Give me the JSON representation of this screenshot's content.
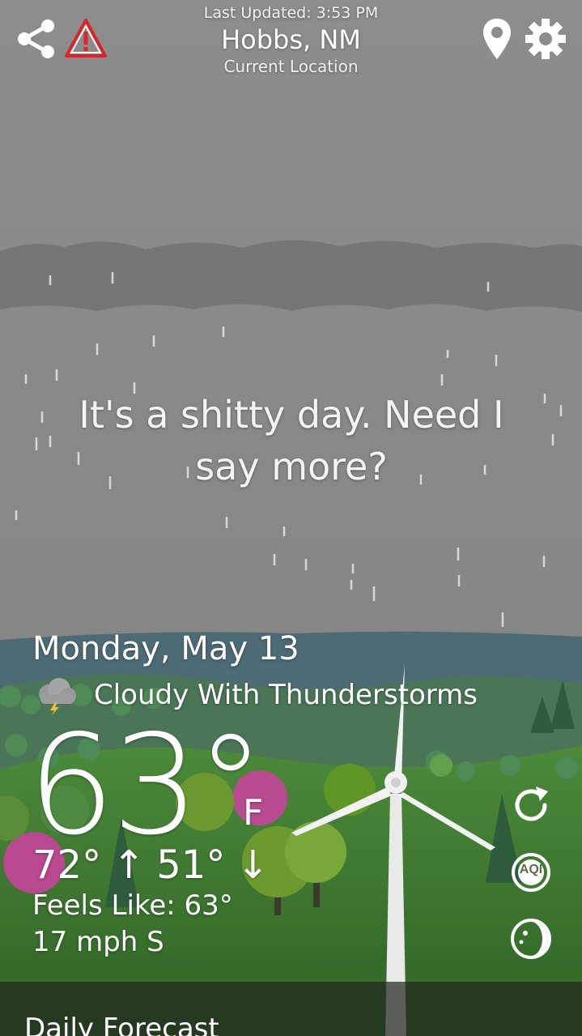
{
  "header": {
    "last_updated": "Last Updated: 3:53 PM",
    "city": "Hobbs, NM",
    "location_subtitle": "Current Location"
  },
  "icons": {
    "share": "share-icon",
    "alert": "alert-icon",
    "location": "map-pin-icon",
    "settings": "gear-icon",
    "condition": "thunderstorm-icon",
    "refresh": "refresh-icon",
    "aqi": "aqi-icon",
    "moon": "moon-icon"
  },
  "quip": "It's a shitty day. Need I say more?",
  "weather": {
    "date": "Monday, May 13",
    "condition": "Cloudy With Thunderstorms",
    "temperature": "63°",
    "unit": "F",
    "high": "72°",
    "high_arrow": "↑",
    "low": "51°",
    "low_arrow": "↓",
    "feels_like": "Feels Like: 63°",
    "wind": "17 mph S"
  },
  "side_buttons": {
    "aqi_label": "AQI"
  },
  "bottom": {
    "daily_forecast_label": "Daily Forecast"
  },
  "colors": {
    "sky": "#8c8c8c",
    "cloud": "#7a7a7a",
    "water": "#4f6e78",
    "grass": "#3f7a33",
    "alert_red": "#d9262c",
    "pink_tree": "#b8488f",
    "green_tree": "#6a9a2f"
  }
}
